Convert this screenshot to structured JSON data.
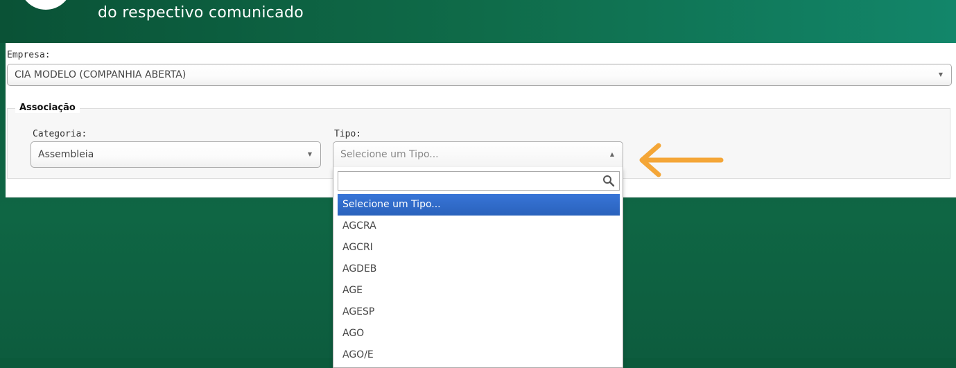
{
  "banner": {
    "text": "do respectivo comunicado"
  },
  "form": {
    "empresa_label": "Empresa:",
    "empresa_value": "CIA MODELO (COMPANHIA ABERTA)",
    "associacao_legend": "Associação",
    "categoria_label": "Categoria:",
    "categoria_value": "Assembleia",
    "tipo_label": "Tipo:",
    "tipo_placeholder": "Selecione um Tipo..."
  },
  "dropdown": {
    "search_value": "",
    "options": [
      "Selecione um Tipo...",
      "AGCRA",
      "AGCRI",
      "AGDEB",
      "AGE",
      "AGESP",
      "AGO",
      "AGO/E"
    ],
    "selected_index": 0
  },
  "colors": {
    "banner_green": "#0f6b49",
    "highlight_blue": "#3875d7",
    "annotation_arrow": "#f4a637"
  },
  "icons": {
    "dropdown_arrow": "triangle-down-icon",
    "dropdown_arrow_open": "triangle-up-icon",
    "search": "search-icon",
    "annotation": "orange-left-arrow-icon"
  }
}
